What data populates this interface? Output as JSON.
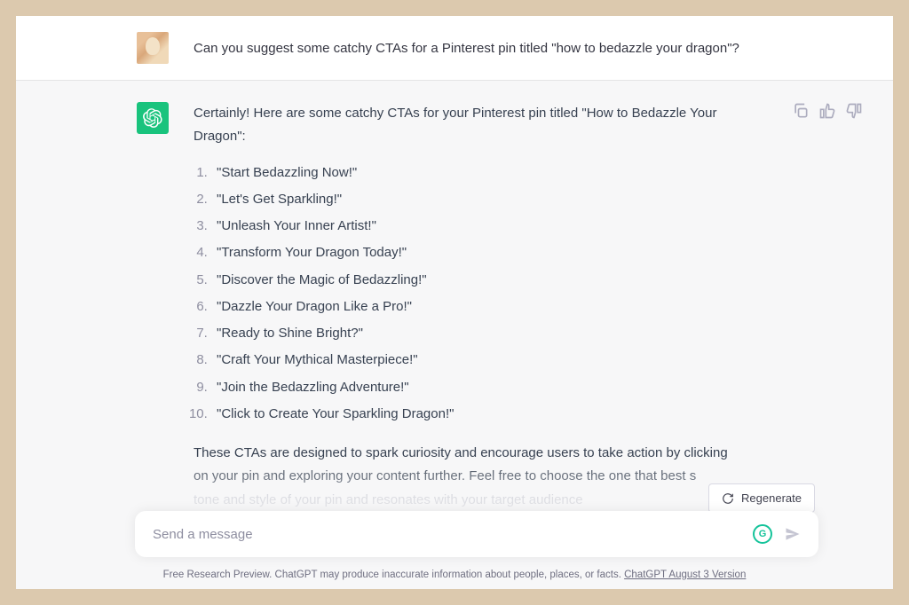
{
  "user": {
    "message": "Can you suggest some catchy CTAs for a Pinterest pin titled \"how to bedazzle your dragon\"?"
  },
  "assistant": {
    "intro": "Certainly! Here are some catchy CTAs for your Pinterest pin titled \"How to Bedazzle Your Dragon\":",
    "list": [
      "\"Start Bedazzling Now!\"",
      "\"Let's Get Sparkling!\"",
      "\"Unleash Your Inner Artist!\"",
      "\"Transform Your Dragon Today!\"",
      "\"Discover the Magic of Bedazzling!\"",
      "\"Dazzle Your Dragon Like a Pro!\"",
      "\"Ready to Shine Bright?\"",
      "\"Craft Your Mythical Masterpiece!\"",
      "\"Join the Bedazzling Adventure!\"",
      "\"Click to Create Your Sparkling Dragon!\""
    ],
    "outro_line1": "These CTAs are designed to spark curiosity and encourage users to take action by clicking",
    "outro_line2": "on your pin and exploring your content further. Feel free to choose the one that best s",
    "outro_line3": "tone and style of your pin and resonates with your target audience"
  },
  "controls": {
    "regenerate": "Regenerate",
    "placeholder": "Send a message"
  },
  "footer": {
    "text": "Free Research Preview. ChatGPT may produce inaccurate information about people, places, or facts. ",
    "version": "ChatGPT August 3 Version"
  }
}
